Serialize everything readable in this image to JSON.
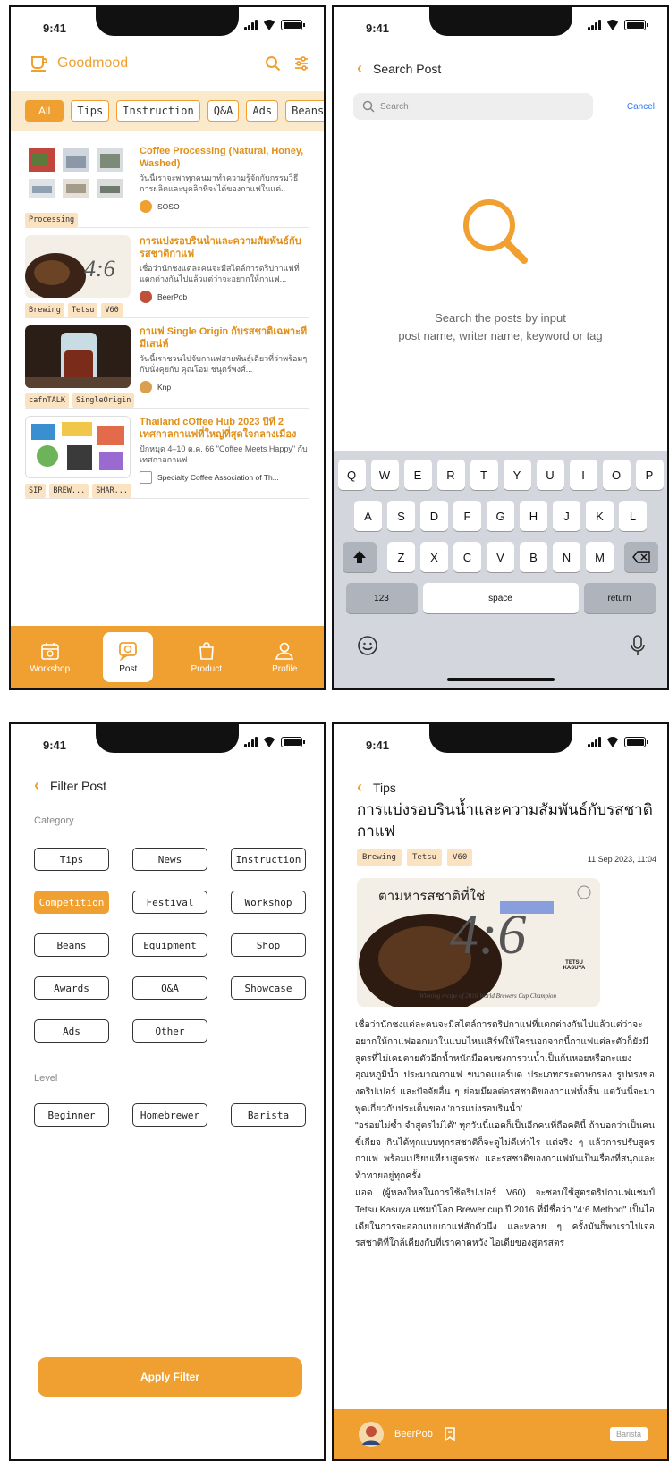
{
  "status": {
    "time": "9:41"
  },
  "feed_screen": {
    "app_name": "Goodmood",
    "filters": [
      "All",
      "Tips",
      "Instruction",
      "Q&A",
      "Ads",
      "Beans"
    ],
    "posts": [
      {
        "title": "Coffee Processing (Natural, Honey, Washed)",
        "desc": "วันนี้เราจะพาทุกคนมาทำความรู้จักกับกรรมวิธีการผลิตและบุคลิกที่จะได้ของกาแฟในแต่..",
        "tags": [
          "Processing"
        ],
        "author": "SOSO"
      },
      {
        "title": "การแบ่งรอบรินน้ำและความสัมพันธ์กับรสชาติกาแฟ",
        "desc": "เชื่อว่านักชงแต่ละคนจะมีสไตล์การดริปกาแฟที่แตกต่างกันไปแล้วแต่ว่าจะอยากให้กาแฟ...",
        "tags": [
          "Brewing",
          "Tetsu",
          "V60"
        ],
        "author": "BeerPob"
      },
      {
        "title": "กาแฟ Single Origin กับรสชาติเฉพาะที่มีเสน่ห์",
        "desc": "วันนี้เราชวนไปจับกาแฟสายพันธุ์เดียวที่ว่าพร้อมๆ กับนั่งคุยกับ คุณโอม ชนุตร์พงศ์...",
        "tags": [
          "cafnTALK",
          "SingleOrigin"
        ],
        "author": "Knp"
      },
      {
        "title": "Thailand cOffee Hub 2023 ปีที่ 2 เทศกาลกาแฟที่ใหญ่ที่สุดใจกลางเมือง",
        "desc": "ปักหมุด 4–10 ต.ค. 66 \"Coffee Meets Happy\" กับเทศกาลกาแฟ",
        "tags": [
          "SIP",
          "BREW...",
          "SHAR..."
        ],
        "author": "Specialty Coffee Association of Th..."
      }
    ],
    "tabs": [
      "Workshop",
      "Post",
      "Product",
      "Profile"
    ]
  },
  "search_screen": {
    "title": "Search Post",
    "placeholder": "Search",
    "cancel": "Cancel",
    "hint_line1": "Search the posts by input",
    "hint_line2": "post name, writer name, keyword or tag",
    "kb_row1": [
      "Q",
      "W",
      "E",
      "R",
      "T",
      "Y",
      "U",
      "I",
      "O",
      "P"
    ],
    "kb_row2": [
      "A",
      "S",
      "D",
      "F",
      "G",
      "H",
      "J",
      "K",
      "L"
    ],
    "kb_row3": [
      "Z",
      "X",
      "C",
      "V",
      "B",
      "N",
      "M"
    ],
    "kb_num": "123",
    "kb_space": "space",
    "kb_return": "return"
  },
  "filter_screen": {
    "title": "Filter Post",
    "category_label": "Category",
    "categories": [
      "Tips",
      "News",
      "Instruction",
      "Competition",
      "Festival",
      "Workshop",
      "Beans",
      "Equipment",
      "Shop",
      "Awards",
      "Q&A",
      "Showcase",
      "Ads",
      "Other"
    ],
    "level_label": "Level",
    "levels": [
      "Beginner",
      "Homebrewer",
      "Barista"
    ],
    "apply": "Apply Filter"
  },
  "article_screen": {
    "crumb": "Tips",
    "title": "การแบ่งรอบรินน้ำและความสัมพันธ์กับรสชาติกาแฟ",
    "tags": [
      "Brewing",
      "Tetsu",
      "V60"
    ],
    "date": "11 Sep 2023, 11:04",
    "hero_text": "ตามหารสชาติที่ใช่",
    "hero_formula": "4:6",
    "hero_brand": "TETSU KASUYA",
    "hero_caption": "Winning recipe of 2016 World Brewers Cup Champion",
    "para1": "เชื่อว่านักชงแต่ละคนจะมีสไตล์การดริปกาแฟที่แตกต่างกันไปแล้วแต่ว่าจะอยากให้กาแฟออกมาในแบบไหนเสิร์ฟให้ใครนอกจากนี้กาแฟแต่ละตัวก็ยังมีสูตรที่ไม่เคยตายตัวอีกน้ำหนักมือคนชงการวนน้ำเป็นก้นหอยหรือกะแยง อุณหภูมิน้ำ ประมาณกาแฟ ขนาดเบอร์บด ประเภทกระดาษกรอง รูปทรงของดริปเปอร์ และปัจจัยอื่น ๆ ย่อมมีผลต่อรสชาติของกาแฟทั้งสิ้น แต่วันนี้จะมาพูดเกี่ยวกับประเด็นของ 'การแบ่งรอบรินน้ำ'",
    "para2": "\"อร่อยไม่ซ้ำ จำสูตรไม่ได้\" ทุกวันนี้แอดก็เป็นอีกคนที่ถือคตินี้ ถ้าบอกว่าเป็นคนขี้เกียจ กินได้ทุกแบบทุกรสชาติก็จะดูไม่ดีเท่าไร แต่จริง ๆ แล้วการปรับสูตรกาแฟ พร้อมเปรียบเทียบสูตรชง และรสชาติของกาแฟมันเป็นเรื่องที่สนุกและท้าทายอยู่ทุกครั้ง",
    "para3": "แอด (ผู้หลงใหลในการใช้ดริปเปอร์ V60) จะชอบใช้สูตรดริปกาแฟแชมป์ Tetsu Kasuya แชมป์โลก Brewer cup ปี 2016 ที่มีชื่อว่า \"4:6 Method\" เป็นไอเดียในการจะออกแบบกาแฟสักตัวนึง และหลาย ๆ ครั้งมันก็พาเราไปเจอรสชาติที่ใกล้เคียงกับที่เราคาดหวัง ไอเดียของสูตรสตร",
    "author": "BeerPob",
    "badge": "Barista"
  }
}
